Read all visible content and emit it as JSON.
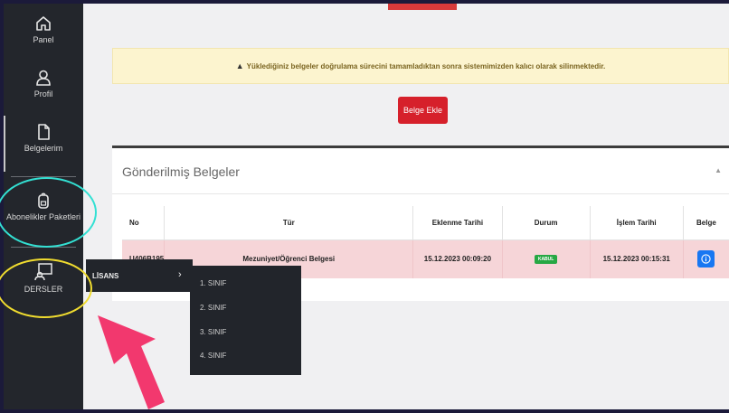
{
  "sidebar": {
    "items": [
      {
        "label": "Panel",
        "icon": "home-icon"
      },
      {
        "label": "Profil",
        "icon": "user-icon"
      },
      {
        "label": "Belgelerim",
        "icon": "document-icon"
      },
      {
        "label": "Abonelikler Paketleri",
        "icon": "backpack-icon"
      },
      {
        "label": "DERSLER",
        "icon": "lesson-icon"
      }
    ],
    "active_item": "Belgelerim"
  },
  "alert": {
    "icon": "warning-icon",
    "text": "Yüklediğiniz belgeler doğrulama sürecini tamamladıktan sonra sistemimizden kalıcı olarak silinmektedir."
  },
  "add_button_label": "Belge Ekle",
  "panel": {
    "title": "Gönderilmiş Belgeler",
    "columns": [
      "No",
      "Tür",
      "Eklenme Tarihi",
      "Durum",
      "İşlem Tarihi",
      "Belge"
    ],
    "rows": [
      {
        "no": "U406B195",
        "type": "Mezuniyet/Öğrenci Belgesi",
        "added": "15.12.2023 00:09:20",
        "status": "KABUL",
        "processed": "15.12.2023 00:15:31",
        "doc_icon": "info-icon"
      }
    ]
  },
  "flyout": {
    "label": "LİSANS",
    "submenu": [
      "1. SINIF",
      "2. SINIF",
      "3. SINIF",
      "4. SINIF"
    ]
  },
  "colors": {
    "sidebar_bg": "#23262c",
    "alert_bg": "#fcf4cf",
    "danger": "#d6202b",
    "row_highlight": "#f6d5d8",
    "success": "#27a844",
    "primary": "#1877f2",
    "annotation_cyan": "#33e0d3",
    "annotation_yellow": "#f0dc2f",
    "annotation_arrow": "#f2386e"
  }
}
